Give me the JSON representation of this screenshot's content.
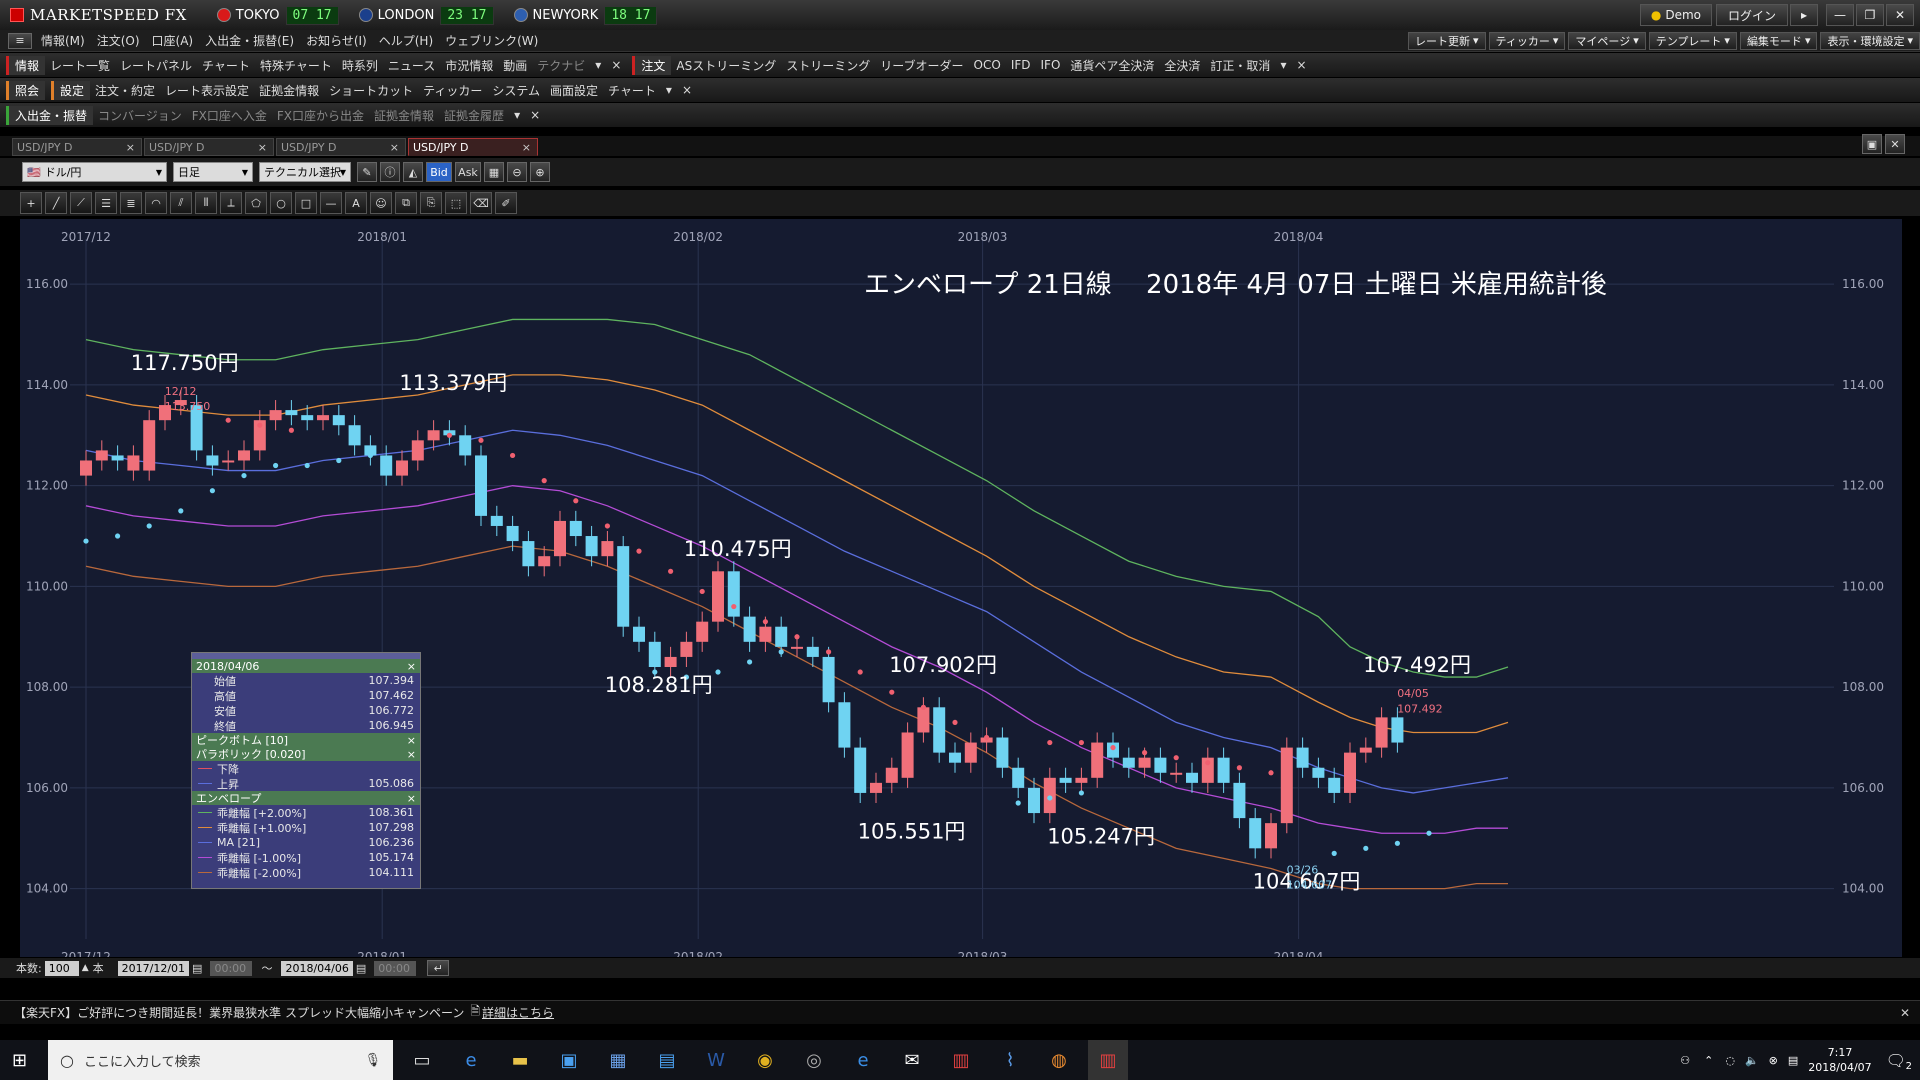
{
  "app": {
    "title": "MARKETSPEED FX"
  },
  "clocks": [
    {
      "city": "TOKYO",
      "time": "07 17",
      "color": "#d91a1a"
    },
    {
      "city": "LONDON",
      "time": "23 17",
      "color": "#1b3f8c"
    },
    {
      "city": "NEWYORK",
      "time": "18 17",
      "color": "#2e5fb0"
    }
  ],
  "titlebar": {
    "demo": "Demo",
    "login": "ログイン"
  },
  "menu": [
    "情報(M)",
    "注文(O)",
    "口座(A)",
    "入出金・振替(E)",
    "お知らせ(I)",
    "ヘルプ(H)",
    "ウェブリンク(W)"
  ],
  "menu_right": [
    "レート更新",
    "ティッカー",
    "マイページ",
    "テンプレート",
    "編集モード",
    "表示・環境設定"
  ],
  "toolbar1": {
    "group1": "情報",
    "items1": [
      "レート一覧",
      "レートパネル",
      "チャート",
      "特殊チャート",
      "時系列",
      "ニュース",
      "市況情報",
      "動画",
      "テクナビ"
    ],
    "group2": "注文",
    "items2": [
      "ASストリーミング",
      "ストリーミング",
      "リーブオーダー",
      "OCO",
      "IFD",
      "IFO",
      "通貨ペア全決済",
      "全決済",
      "訂正・取消"
    ]
  },
  "toolbar2": {
    "group1": "照会",
    "group2": "設定",
    "items": [
      "注文・約定",
      "レート表示設定",
      "証拠金情報",
      "ショートカット",
      "ティッカー",
      "システム",
      "画面設定",
      "チャート"
    ]
  },
  "toolbar3": {
    "group1": "入出金・振替",
    "items": [
      "コンバージョン",
      "FX口座へ入金",
      "FX口座から出金",
      "証拠金情報",
      "証拠金履歴"
    ]
  },
  "chart_tabs": [
    "USD/JPY D",
    "USD/JPY D",
    "USD/JPY D",
    "USD/JPY D"
  ],
  "controls": {
    "pair": "ドル/円",
    "period": "日足",
    "tech": "テクニカル選択",
    "bid": "Bid",
    "ask": "Ask"
  },
  "chart_data": {
    "type": "candlestick",
    "title": "エンベロープ 21日線　 2018年 4月 07日 土曜日 米雇用統計後",
    "xlabels": [
      "2017/12",
      "2018/01",
      "2018/02",
      "2018/03",
      "2018/04"
    ],
    "ylabels": [
      "116.00",
      "114.00",
      "112.00",
      "110.00",
      "108.00",
      "106.00",
      "104.00"
    ],
    "ylim": [
      103.0,
      116.5
    ],
    "annotations": [
      {
        "text": "117.750円",
        "n": 6,
        "v": 114.3
      },
      {
        "text": "113.379円",
        "n": 23,
        "v": 113.9
      },
      {
        "text": "110.475円",
        "n": 41,
        "v": 110.6
      },
      {
        "text": "108.281円",
        "n": 36,
        "v": 107.9
      },
      {
        "text": "107.902円",
        "n": 54,
        "v": 108.3
      },
      {
        "text": "105.551円",
        "n": 52,
        "v": 105.0
      },
      {
        "text": "105.247円",
        "n": 64,
        "v": 104.9
      },
      {
        "text": "104.607円",
        "n": 77,
        "v": 104.0
      },
      {
        "text": "107.492円",
        "n": 84,
        "v": 108.3
      }
    ],
    "small_marks": [
      {
        "text": "12/12",
        "n": 6,
        "v": 113.8
      },
      {
        "text": "113.750",
        "n": 6,
        "v": 113.5
      },
      {
        "text": "04/05",
        "n": 84,
        "v": 107.8
      },
      {
        "text": "107.492",
        "n": 84,
        "v": 107.5
      },
      {
        "text": "03/26",
        "n": 77,
        "v": 104.3
      },
      {
        "text": "104.607",
        "n": 77,
        "v": 104.0
      }
    ],
    "candles_oc": [
      [
        112.2,
        112.5
      ],
      [
        112.5,
        112.7
      ],
      [
        112.6,
        112.5
      ],
      [
        112.3,
        112.6
      ],
      [
        112.3,
        113.3
      ],
      [
        113.3,
        113.6
      ],
      [
        113.6,
        113.7
      ],
      [
        113.6,
        112.7
      ],
      [
        112.6,
        112.4
      ],
      [
        112.5,
        112.5
      ],
      [
        112.5,
        112.7
      ],
      [
        112.7,
        113.3
      ],
      [
        113.3,
        113.5
      ],
      [
        113.5,
        113.4
      ],
      [
        113.4,
        113.3
      ],
      [
        113.3,
        113.4
      ],
      [
        113.4,
        113.2
      ],
      [
        113.2,
        112.8
      ],
      [
        112.8,
        112.6
      ],
      [
        112.6,
        112.2
      ],
      [
        112.2,
        112.5
      ],
      [
        112.5,
        112.9
      ],
      [
        112.9,
        113.1
      ],
      [
        113.1,
        113.0
      ],
      [
        113.0,
        112.6
      ],
      [
        112.6,
        111.4
      ],
      [
        111.4,
        111.2
      ],
      [
        111.2,
        110.9
      ],
      [
        110.9,
        110.4
      ],
      [
        110.4,
        110.6
      ],
      [
        110.6,
        111.3
      ],
      [
        111.3,
        111.0
      ],
      [
        111.0,
        110.6
      ],
      [
        110.6,
        110.9
      ],
      [
        110.8,
        109.2
      ],
      [
        109.2,
        108.9
      ],
      [
        108.9,
        108.4
      ],
      [
        108.4,
        108.6
      ],
      [
        108.6,
        108.9
      ],
      [
        108.9,
        109.3
      ],
      [
        109.3,
        110.3
      ],
      [
        110.3,
        109.4
      ],
      [
        109.4,
        108.9
      ],
      [
        108.9,
        109.2
      ],
      [
        109.2,
        108.8
      ],
      [
        108.8,
        108.8
      ],
      [
        108.8,
        108.6
      ],
      [
        108.6,
        107.7
      ],
      [
        107.7,
        106.8
      ],
      [
        106.8,
        105.9
      ],
      [
        105.9,
        106.1
      ],
      [
        106.1,
        106.4
      ],
      [
        106.2,
        107.1
      ],
      [
        107.1,
        107.6
      ],
      [
        107.6,
        106.7
      ],
      [
        106.7,
        106.5
      ],
      [
        106.5,
        106.9
      ],
      [
        106.9,
        107.0
      ],
      [
        107.0,
        106.4
      ],
      [
        106.4,
        106.0
      ],
      [
        106.0,
        105.5
      ],
      [
        105.5,
        106.2
      ],
      [
        106.2,
        106.1
      ],
      [
        106.1,
        106.2
      ],
      [
        106.2,
        106.9
      ],
      [
        106.9,
        106.6
      ],
      [
        106.6,
        106.4
      ],
      [
        106.4,
        106.6
      ],
      [
        106.6,
        106.3
      ],
      [
        106.3,
        106.3
      ],
      [
        106.3,
        106.1
      ],
      [
        106.1,
        106.6
      ],
      [
        106.6,
        106.1
      ],
      [
        106.1,
        105.4
      ],
      [
        105.4,
        104.8
      ],
      [
        104.8,
        105.3
      ],
      [
        105.3,
        106.8
      ],
      [
        106.8,
        106.4
      ],
      [
        106.4,
        106.2
      ],
      [
        106.2,
        105.9
      ],
      [
        105.9,
        106.7
      ],
      [
        106.7,
        106.8
      ],
      [
        106.8,
        107.4
      ],
      [
        107.4,
        106.9
      ]
    ],
    "sar_upper": [
      [
        9,
        113.3
      ],
      [
        11,
        113.2
      ],
      [
        13,
        113.1
      ],
      [
        23,
        113.0
      ],
      [
        25,
        112.9
      ],
      [
        27,
        112.6
      ],
      [
        29,
        112.1
      ],
      [
        31,
        111.7
      ],
      [
        33,
        111.2
      ],
      [
        35,
        110.7
      ],
      [
        37,
        110.3
      ],
      [
        39,
        109.9
      ],
      [
        41,
        109.6
      ],
      [
        43,
        109.3
      ],
      [
        45,
        109.0
      ],
      [
        47,
        108.7
      ],
      [
        49,
        108.3
      ],
      [
        51,
        107.9
      ],
      [
        53,
        107.6
      ],
      [
        55,
        107.3
      ],
      [
        57,
        107.0
      ],
      [
        61,
        106.9
      ],
      [
        63,
        106.9
      ],
      [
        65,
        106.8
      ],
      [
        67,
        106.7
      ],
      [
        69,
        106.6
      ],
      [
        71,
        106.5
      ],
      [
        73,
        106.4
      ],
      [
        75,
        106.3
      ]
    ],
    "sar_lower": [
      [
        0,
        110.9
      ],
      [
        2,
        111.0
      ],
      [
        4,
        111.2
      ],
      [
        6,
        111.5
      ],
      [
        8,
        111.9
      ],
      [
        10,
        112.2
      ],
      [
        12,
        112.4
      ],
      [
        14,
        112.4
      ],
      [
        16,
        112.5
      ],
      [
        18,
        112.6
      ],
      [
        36,
        108.3
      ],
      [
        38,
        108.2
      ],
      [
        40,
        108.3
      ],
      [
        42,
        108.5
      ],
      [
        44,
        108.7
      ],
      [
        59,
        105.7
      ],
      [
        61,
        105.8
      ],
      [
        63,
        105.9
      ],
      [
        79,
        104.7
      ],
      [
        81,
        104.8
      ],
      [
        83,
        104.9
      ],
      [
        85,
        105.1
      ]
    ],
    "series": [
      {
        "name": "乖離幅 [+2.00%]",
        "color": "#5fb45f",
        "values": [
          114.9,
          114.7,
          114.6,
          114.5,
          114.5,
          114.7,
          114.8,
          114.9,
          115.1,
          115.3,
          115.3,
          115.3,
          115.2,
          114.9,
          114.6,
          114.1,
          113.6,
          113.1,
          112.6,
          112.1,
          111.5,
          111.0,
          110.5,
          110.2,
          110.0,
          109.9,
          109.4,
          108.8,
          108.5,
          108.3,
          108.2,
          108.2,
          108.4
        ]
      },
      {
        "name": "乖離幅 [+1.00%]",
        "color": "#e08c3c",
        "values": [
          113.8,
          113.6,
          113.5,
          113.4,
          113.4,
          113.6,
          113.7,
          113.8,
          114.0,
          114.2,
          114.2,
          114.1,
          113.9,
          113.6,
          113.1,
          112.6,
          112.1,
          111.6,
          111.1,
          110.6,
          110.0,
          109.5,
          109.0,
          108.6,
          108.3,
          108.2,
          107.7,
          107.4,
          107.2,
          107.1,
          107.1,
          107.1,
          107.3
        ]
      },
      {
        "name": "MA [21]",
        "color": "#5a6edc",
        "values": [
          112.7,
          112.5,
          112.4,
          112.3,
          112.3,
          112.5,
          112.6,
          112.7,
          112.9,
          113.1,
          113.0,
          112.8,
          112.5,
          112.2,
          111.7,
          111.2,
          110.7,
          110.3,
          109.9,
          109.5,
          108.9,
          108.3,
          107.8,
          107.3,
          107.0,
          106.8,
          106.4,
          106.2,
          106.0,
          105.9,
          106.0,
          106.1,
          106.2
        ]
      },
      {
        "name": "乖離幅 [-1.00%]",
        "color": "#b44cd6",
        "values": [
          111.6,
          111.4,
          111.3,
          111.2,
          111.2,
          111.4,
          111.5,
          111.6,
          111.8,
          112.0,
          111.9,
          111.6,
          111.2,
          110.8,
          110.3,
          109.8,
          109.3,
          108.8,
          108.4,
          107.9,
          107.3,
          106.8,
          106.4,
          106.0,
          105.8,
          105.6,
          105.3,
          105.2,
          105.1,
          105.1,
          105.1,
          105.2,
          105.2
        ]
      },
      {
        "name": "乖離幅 [-2.00%]",
        "color": "#b8683c",
        "values": [
          110.4,
          110.2,
          110.1,
          110.0,
          110.0,
          110.2,
          110.3,
          110.4,
          110.6,
          110.8,
          110.7,
          110.4,
          110.0,
          109.6,
          109.1,
          108.6,
          108.1,
          107.6,
          107.2,
          106.7,
          106.1,
          105.6,
          105.2,
          104.8,
          104.6,
          104.4,
          104.1,
          104.0,
          104.0,
          104.0,
          104.0,
          104.1,
          104.1
        ]
      }
    ],
    "env_x": [
      0,
      3,
      6,
      9,
      12,
      15,
      18,
      21,
      24,
      27,
      30,
      33,
      36,
      39,
      42,
      45,
      48,
      51,
      54,
      57,
      60,
      63,
      66,
      69,
      72,
      75,
      78,
      80,
      82,
      84,
      86,
      88,
      90
    ],
    "grid": true
  },
  "ohlc_panel": {
    "date": "2018/04/06",
    "rows": [
      {
        "k": "始値",
        "v": "107.394"
      },
      {
        "k": "高値",
        "v": "107.462"
      },
      {
        "k": "安値",
        "v": "106.772"
      },
      {
        "k": "終値",
        "v": "106.945"
      }
    ],
    "peak": "ピークボトム [10]",
    "para": "パラボリック [0.020]",
    "para_rows": [
      {
        "k": "下降",
        "v": "",
        "c": "#e05060"
      },
      {
        "k": "上昇",
        "v": "105.086",
        "c": "#5a6edc"
      }
    ],
    "env": "エンベロープ",
    "env_rows": [
      {
        "k": "乖離幅 [+2.00%]",
        "v": "108.361",
        "c": "#5fb45f"
      },
      {
        "k": "乖離幅 [+1.00%]",
        "v": "107.298",
        "c": "#e08c3c"
      },
      {
        "k": "MA [21]",
        "v": "106.236",
        "c": "#5a6edc"
      },
      {
        "k": "乖離幅 [-1.00%]",
        "v": "105.174",
        "c": "#b44cd6"
      },
      {
        "k": "乖離幅 [-2.00%]",
        "v": "104.111",
        "c": "#b8683c"
      }
    ]
  },
  "bottom": {
    "count_label": "本数:",
    "count": "100",
    "unit": "本",
    "from": "2017/12/01",
    "from_t": "00:00",
    "to": "2018/04/06",
    "to_t": "00:00",
    "tilde": "～"
  },
  "news": {
    "text": "【楽天FX】ご好評につき期間延長！業界最狭水準 スプレッド大幅縮小キャンペーン",
    "link": "詳細はこちら"
  },
  "taskbar": {
    "search": "ここに入力して検索",
    "time": "7:17",
    "date": "2018/04/07",
    "badge": "2"
  }
}
